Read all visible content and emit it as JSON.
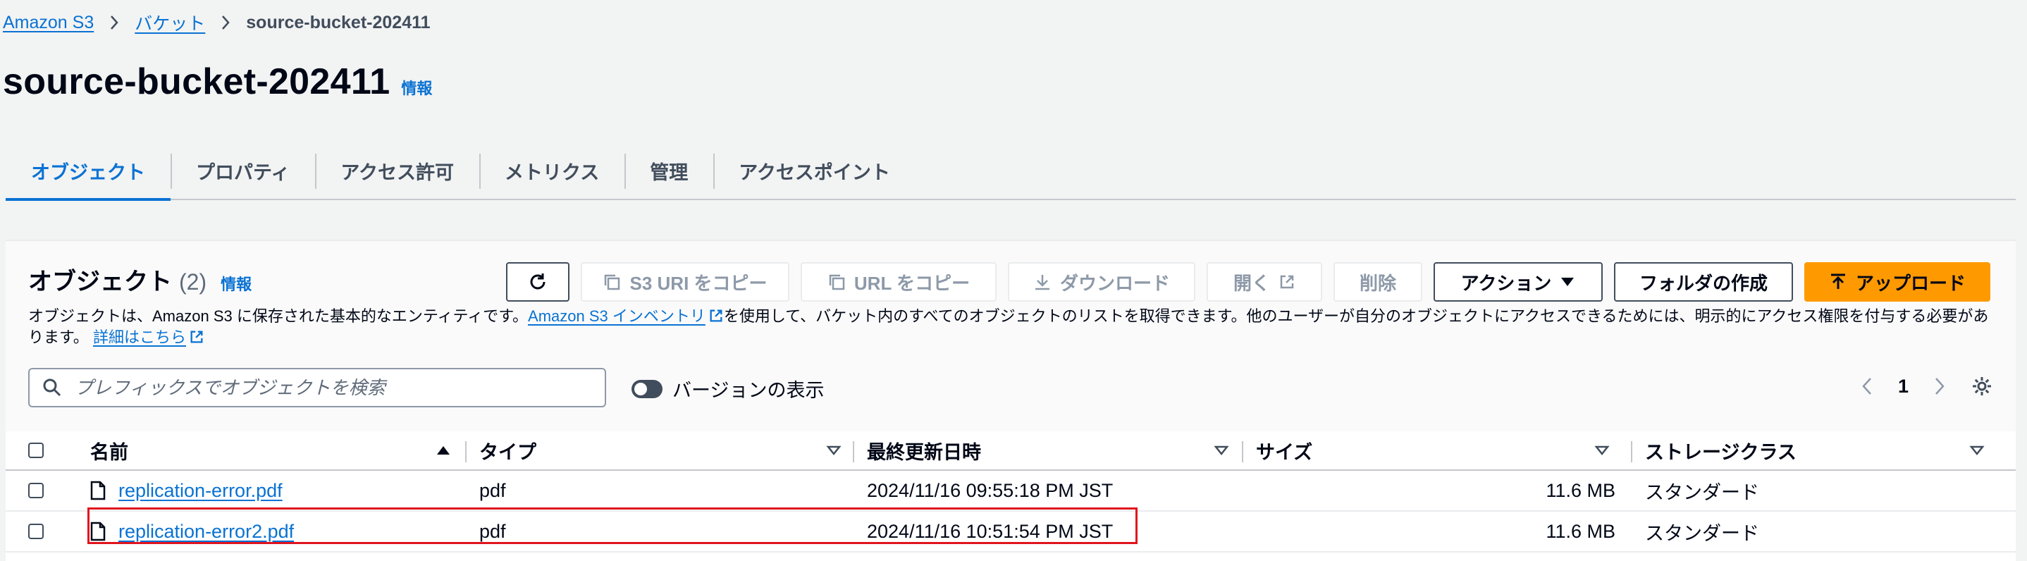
{
  "breadcrumb": {
    "items": [
      "Amazon S3",
      "バケット"
    ],
    "current": "source-bucket-202411"
  },
  "page": {
    "title": "source-bucket-202411",
    "info_label": "情報"
  },
  "tabs": [
    {
      "label": "オブジェクト",
      "active": true
    },
    {
      "label": "プロパティ"
    },
    {
      "label": "アクセス許可"
    },
    {
      "label": "メトリクス"
    },
    {
      "label": "管理"
    },
    {
      "label": "アクセスポイント"
    }
  ],
  "objects_panel": {
    "title": "オブジェクト",
    "count": "(2)",
    "info_label": "情報",
    "buttons": {
      "copy_s3_uri": "S3 URI をコピー",
      "copy_url": "URL をコピー",
      "download": "ダウンロード",
      "open": "開く",
      "delete": "削除",
      "actions": "アクション",
      "create_folder": "フォルダの作成",
      "upload": "アップロード"
    },
    "description": {
      "part1": "オブジェクトは、Amazon S3 に保存された基本的なエンティティです。",
      "inventory_link": "Amazon S3 インベントリ",
      "part2": "を使用して、バケット内のすべてのオブジェクトのリストを取得できます。他のユーザーが自分のオブジェクトにアクセスできるためには、明示的にアクセス権限を付与する必要があります。",
      "details_link": "詳細はこちら"
    },
    "search": {
      "placeholder": "プレフィックスでオブジェクトを検索",
      "value": ""
    },
    "show_versions_label": "バージョンの表示",
    "pagination": {
      "current_page": "1"
    }
  },
  "table": {
    "columns": [
      "名前",
      "タイプ",
      "最終更新日時",
      "サイズ",
      "ストレージクラス"
    ],
    "rows": [
      {
        "name": "replication-error.pdf",
        "type": "pdf",
        "modified": "2024/11/16 09:55:18 PM JST",
        "size": "11.6 MB",
        "storage_class": "スタンダード"
      },
      {
        "name": "replication-error2.pdf",
        "type": "pdf",
        "modified": "2024/11/16 10:51:54 PM JST",
        "size": "11.6 MB",
        "storage_class": "スタンダード"
      }
    ]
  },
  "colors": {
    "link": "#0972d3",
    "primary_button": "#ff9900",
    "highlight_box": "#e0141e"
  }
}
